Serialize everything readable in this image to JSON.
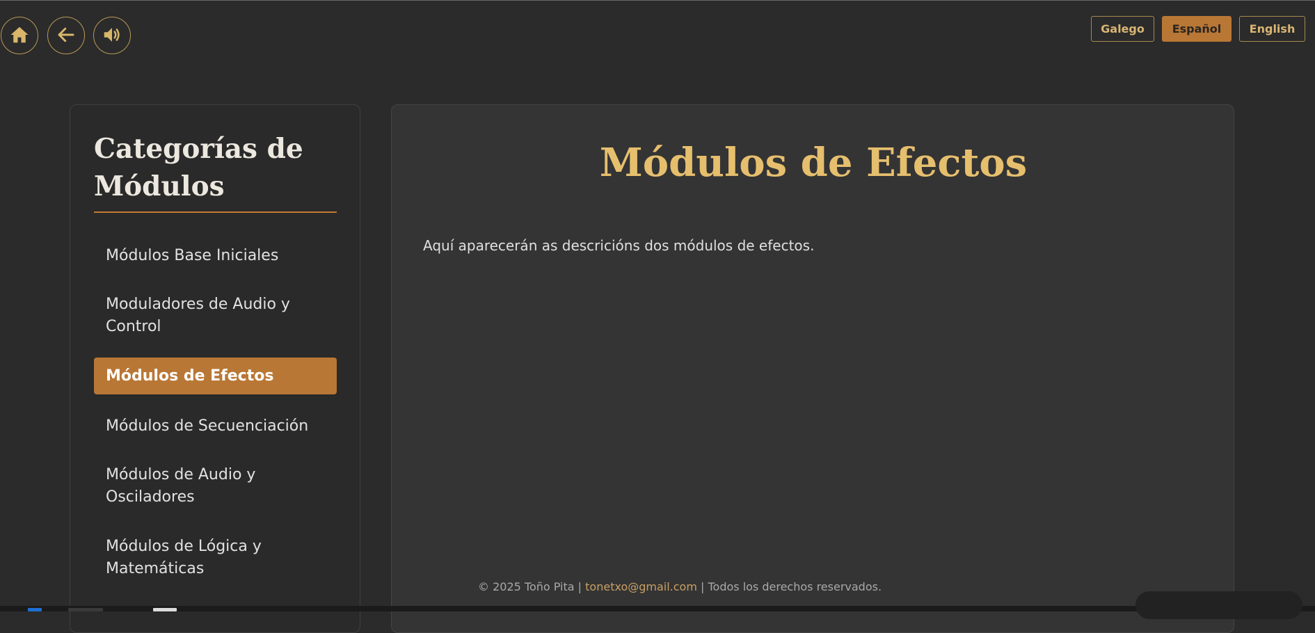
{
  "toolbar": {
    "home_icon": "home-icon",
    "back_icon": "arrow-left-icon",
    "sound_icon": "speaker-icon"
  },
  "languages": [
    {
      "label": "Galego",
      "selected": false
    },
    {
      "label": "Español",
      "selected": true
    },
    {
      "label": "English",
      "selected": false
    }
  ],
  "sidebar": {
    "title": "Categorías de Módulos",
    "items": [
      {
        "label": "Módulos Base Iniciales",
        "active": false
      },
      {
        "label": "Moduladores de Audio y Control",
        "active": false
      },
      {
        "label": "Módulos de Efectos",
        "active": true
      },
      {
        "label": "Módulos de Secuenciación",
        "active": false
      },
      {
        "label": "Módulos de Audio y Osciladores",
        "active": false
      },
      {
        "label": "Módulos de Lógica y Matemáticas",
        "active": false
      }
    ]
  },
  "main": {
    "title": "Módulos de Efectos",
    "description": "Aquí aparecerán as descricións dos módulos de efectos."
  },
  "footer": {
    "prefix": "© 2025 Toño Pita | ",
    "email": "tonetxo@gmail.com",
    "suffix": " | Todos los derechos reservados."
  },
  "colors": {
    "accent": "#b97735",
    "title_gold": "#e6bf6e",
    "background": "#2b2b2b",
    "panel": "#343434"
  }
}
